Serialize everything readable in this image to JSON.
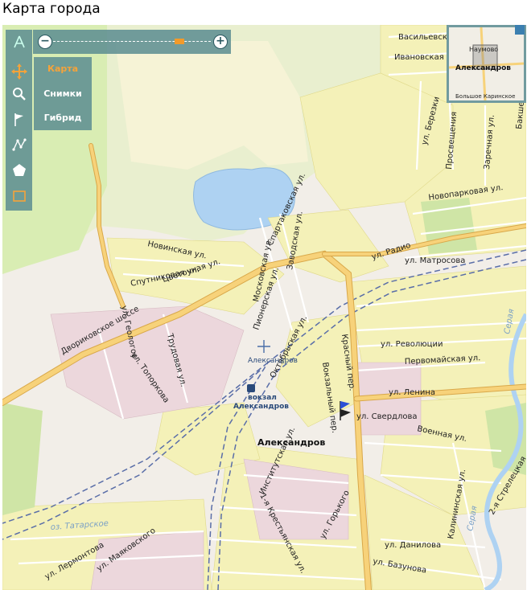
{
  "title": "Карта города",
  "modes": [
    {
      "label": "Карта",
      "active": true
    },
    {
      "label": "Снимки",
      "active": false
    },
    {
      "label": "Гибрид",
      "active": false
    }
  ],
  "zoom": {
    "minus": "−",
    "plus": "+",
    "level_fraction": 0.82
  },
  "minimap": {
    "labels": [
      "Наумово",
      "Александров",
      "Большое Каринское"
    ]
  },
  "city_label": "Александров",
  "station": {
    "name": "вокзал Александров",
    "line1": "вокзал",
    "line2": "Александров",
    "stop": "Александров"
  },
  "water": {
    "lake": "оз. Татарское",
    "river": "Серая"
  },
  "streets": [
    "Васильевская ул.",
    "Ивановская ул.",
    "ул. Березки",
    "Просвещения",
    "Заречная ул.",
    "Бакшеева",
    "Новопарковая ул.",
    "Спартаковская ул.",
    "Заводская ул.",
    "Новинская ул.",
    "ул. Радио",
    "ул. Матросова",
    "Спутниковая ул.",
    "Цветочная ул.",
    "Московская ул.",
    "Пионерская ул.",
    "ул. Геологов",
    "Двориковское шоссе",
    "Трудовая ул.",
    "ул. Топоркова",
    "Октябрьская ул.",
    "Вокзальный пер.",
    "Красный пер.",
    "ул. Революции",
    "Первомайская ул.",
    "ул. Ленина",
    "ул. Свердлова",
    "Военная ул.",
    "Институтская ул.",
    "1-я Крестьянская ул.",
    "ул. Горького",
    "ул. Лермонтова",
    "ул. Маяковского",
    "ул. Данилова",
    "ул. Базунова",
    "Калининская ул.",
    "2-я Стрелецкая",
    "Большое Каринское",
    "Наумово"
  ],
  "colors": {
    "road_major": "#f7d27a",
    "road_casing": "#d9a84a",
    "block": "#f4f1b8",
    "park": "#d9edb3",
    "water": "#aed2f2",
    "panel": "#5a8c91",
    "accent": "#f5a33a"
  }
}
